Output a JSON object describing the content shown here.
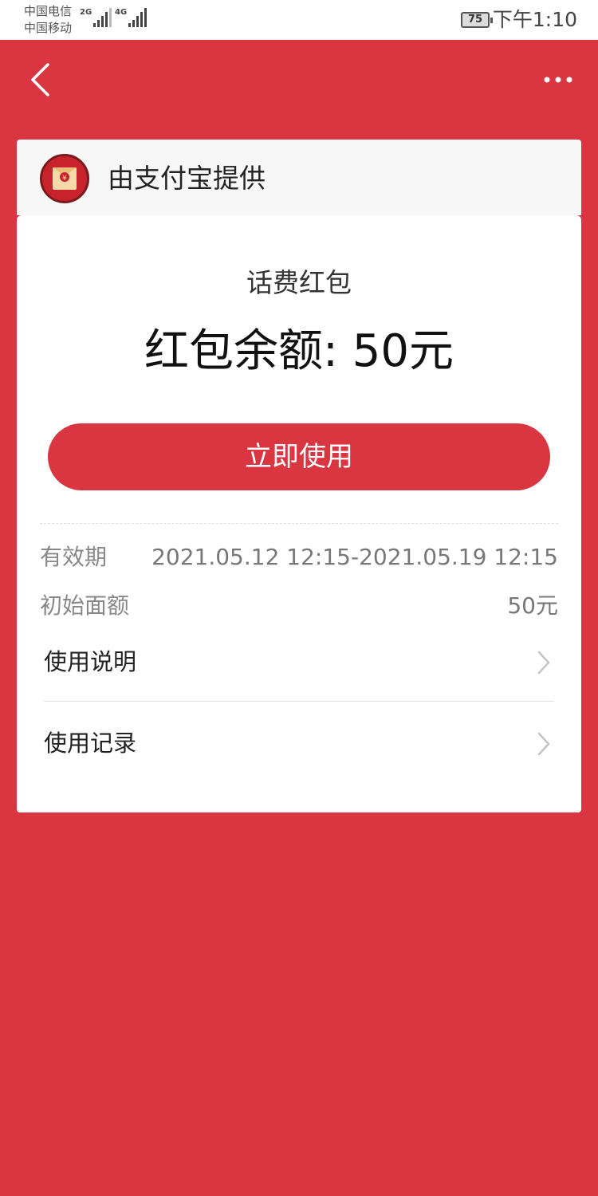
{
  "status_bar": {
    "carrier_1": "中国电信",
    "carrier_2": "中国移动",
    "network_1": "2G",
    "network_2": "4G",
    "battery": "75",
    "time": "下午1:10"
  },
  "nav": {
    "back_icon": "chevron-left-icon",
    "more_icon": "more-horizontal-icon"
  },
  "card": {
    "provider": "由支付宝提供",
    "provider_icon": "red-envelope-icon",
    "subtitle": "话费红包",
    "balance": "红包余额: 50元",
    "use_button": "立即使用",
    "validity_label": "有效期",
    "validity_value": "2021.05.12 12:15-2021.05.19 12:15",
    "initial_label": "初始面额",
    "initial_value": "50元",
    "instructions_label": "使用说明",
    "records_label": "使用记录"
  },
  "colors": {
    "brand_red": "#d93641",
    "card_header_bg": "#f7f7f7"
  }
}
